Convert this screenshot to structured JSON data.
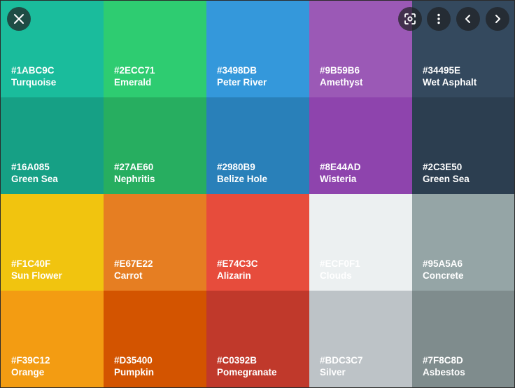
{
  "controls": {
    "close": "close-icon",
    "lens": "lens-search-icon",
    "more": "more-vertical-icon",
    "prev": "chevron-left-icon",
    "next": "chevron-right-icon"
  },
  "swatches": [
    {
      "hex": "#1ABC9C",
      "name": "Turquoise",
      "color": "#1ABC9C"
    },
    {
      "hex": "#2ECC71",
      "name": "Emerald",
      "color": "#2ECC71"
    },
    {
      "hex": "#3498DB",
      "name": "Peter River",
      "color": "#3498DB"
    },
    {
      "hex": "#9B59B6",
      "name": "Amethyst",
      "color": "#9B59B6"
    },
    {
      "hex": "#34495E",
      "name": "Wet Asphalt",
      "color": "#34495E"
    },
    {
      "hex": "#16A085",
      "name": "Green Sea",
      "color": "#16A085"
    },
    {
      "hex": "#27AE60",
      "name": "Nephritis",
      "color": "#27AE60"
    },
    {
      "hex": "#2980B9",
      "name": "Belize Hole",
      "color": "#2980B9"
    },
    {
      "hex": "#8E44AD",
      "name": "Wisteria",
      "color": "#8E44AD"
    },
    {
      "hex": "#2C3E50",
      "name": "Green Sea",
      "color": "#2C3E50"
    },
    {
      "hex": "#F1C40F",
      "name": "Sun Flower",
      "color": "#F1C40F"
    },
    {
      "hex": "#E67E22",
      "name": "Carrot",
      "color": "#E67E22"
    },
    {
      "hex": "#E74C3C",
      "name": "Alizarin",
      "color": "#E74C3C"
    },
    {
      "hex": "#ECF0F1",
      "name": "Clouds",
      "color": "#ECF0F1"
    },
    {
      "hex": "#95A5A6",
      "name": "Concrete",
      "color": "#95A5A6"
    },
    {
      "hex": "#F39C12",
      "name": "Orange",
      "color": "#F39C12"
    },
    {
      "hex": "#D35400",
      "name": "Pumpkin",
      "color": "#D35400"
    },
    {
      "hex": "#C0392B",
      "name": "Pomegranate",
      "color": "#C0392B"
    },
    {
      "hex": "#BDC3C7",
      "name": "Silver",
      "color": "#BDC3C7"
    },
    {
      "hex": "#7F8C8D",
      "name": "Asbestos",
      "color": "#7F8C8D"
    }
  ]
}
